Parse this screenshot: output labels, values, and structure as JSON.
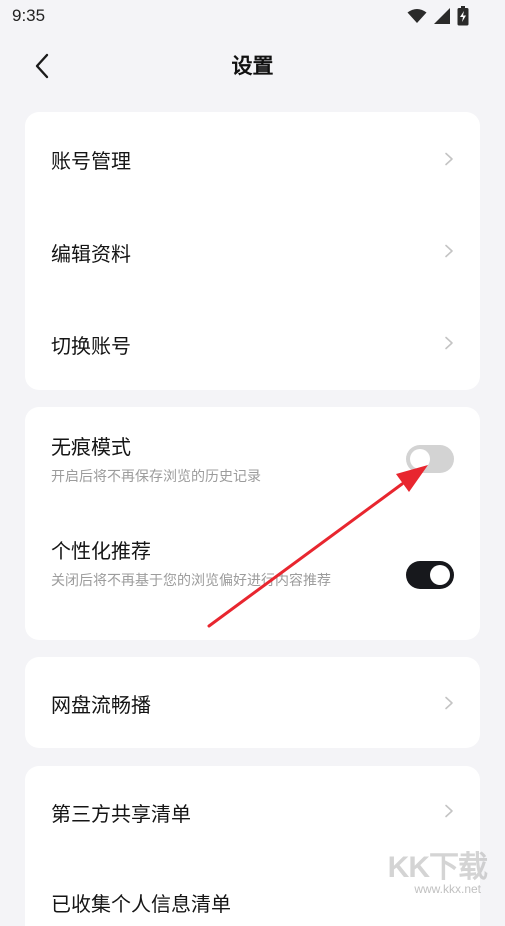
{
  "status_bar": {
    "time": "9:35",
    "icons": [
      "wifi-icon",
      "signal-icon",
      "battery-charging-icon"
    ]
  },
  "header": {
    "title": "设置",
    "back_icon": "chevron-left-icon"
  },
  "account_section": {
    "items": [
      {
        "label": "账号管理"
      },
      {
        "label": "编辑资料"
      },
      {
        "label": "切换账号"
      }
    ]
  },
  "privacy_section": {
    "incognito": {
      "label": "无痕模式",
      "description": "开启后将不再保存浏览的历史记录",
      "enabled": false
    },
    "personalized": {
      "label": "个性化推荐",
      "description": "关闭后将不再基于您的浏览偏好进行内容推荐",
      "enabled": true
    }
  },
  "netdisk_section": {
    "label": "网盘流畅播"
  },
  "sharing_section": {
    "items": [
      {
        "label": "第三方共享清单"
      },
      {
        "label": "已收集个人信息清单"
      }
    ]
  },
  "annotation": {
    "arrow_color": "#e8262f"
  },
  "watermark": {
    "logo": "KK下载",
    "url": "www.kkx.net"
  },
  "colors": {
    "background": "#f4f4f7",
    "card": "#ffffff",
    "toggle_on": "#17181c",
    "toggle_off": "#d3d3d3"
  }
}
